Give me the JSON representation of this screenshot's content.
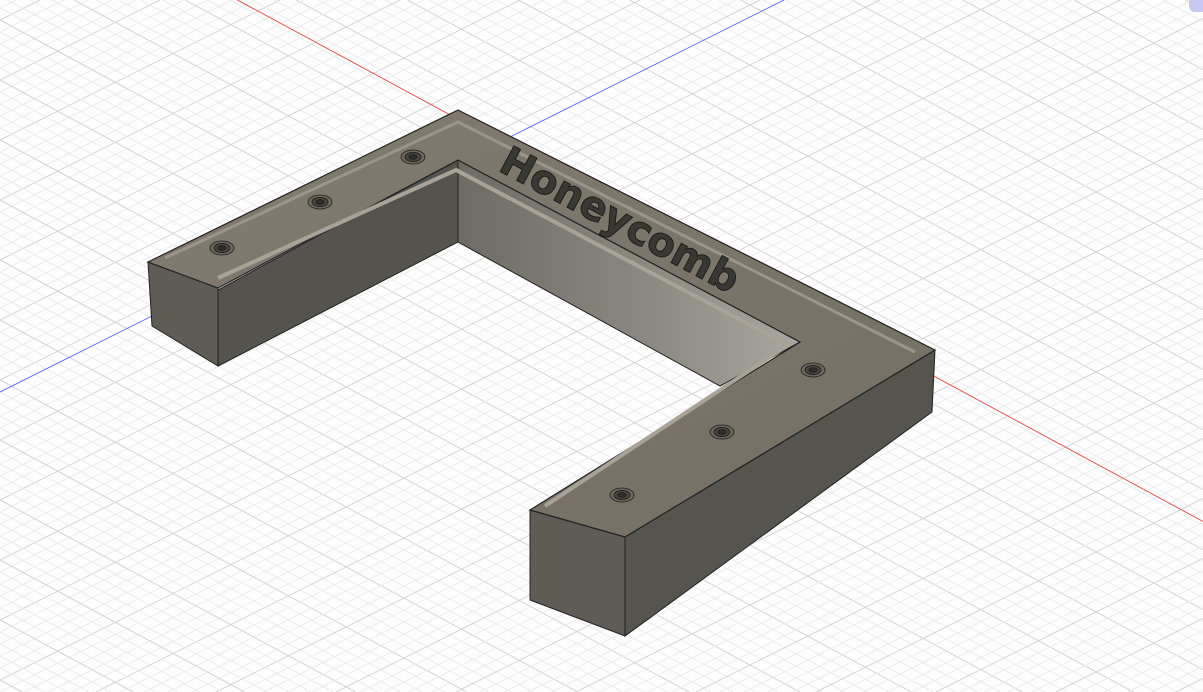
{
  "viewport": {
    "engraved_text": "Honeycomb",
    "colors": {
      "grid_minor": "#ececec",
      "grid_major": "#d4d4d4",
      "x_axis": "#e05555",
      "z_axis": "#6b6bf0",
      "part_top": "#7b7569",
      "part_side_dark": "#54524c",
      "part_inner_wall": "#8d8a82"
    },
    "hole_count": 6
  }
}
